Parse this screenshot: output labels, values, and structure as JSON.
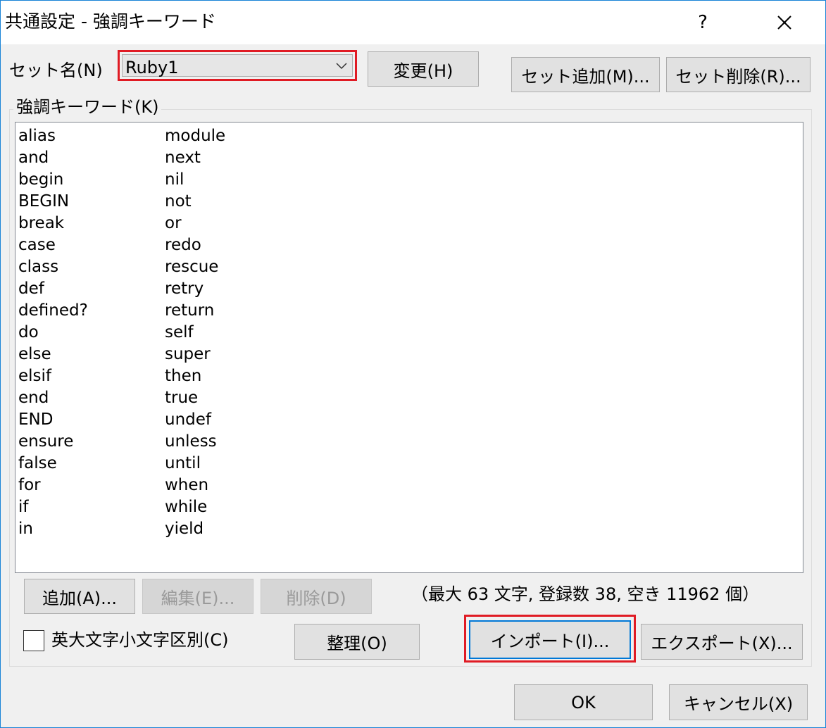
{
  "window": {
    "title": "共通設定 - 強調キーワード",
    "help_label": "?",
    "close_label": "✕"
  },
  "set": {
    "label": "セット名(N)",
    "selected": "Ruby1",
    "change_button": "変更(H)",
    "add_set_button": "セット追加(M)...",
    "delete_set_button": "セット削除(R)..."
  },
  "keywords": {
    "group_label": "強調キーワード(K)",
    "column1": [
      "alias",
      "and",
      "begin",
      "BEGIN",
      "break",
      "case",
      "class",
      "def",
      "defined?",
      "do",
      "else",
      "elsif",
      "end",
      "END",
      "ensure",
      "false",
      "for",
      "if",
      "in"
    ],
    "column2": [
      "module",
      "next",
      "nil",
      "not",
      "or",
      "redo",
      "rescue",
      "retry",
      "return",
      "self",
      "super",
      "then",
      "true",
      "undef",
      "unless",
      "until",
      "when",
      "while",
      "yield"
    ]
  },
  "actions": {
    "add_button": "追加(A)...",
    "edit_button": "編集(E)...",
    "delete_button": "削除(D)",
    "stats_text": "（最大 63 文字, 登録数 38, 空き 11962 個）",
    "case_sensitive_label": "英大文字小文字区別(C)",
    "case_sensitive_checked": false,
    "organize_button": "整理(O)",
    "import_button": "インポート(I)...",
    "export_button": "エクスポート(X)..."
  },
  "footer": {
    "ok_button": "OK",
    "cancel_button": "キャンセル(X)"
  },
  "colors": {
    "highlight_frame": "#e01b24",
    "focus_border": "#0078d7",
    "window_border": "#1883d7"
  }
}
